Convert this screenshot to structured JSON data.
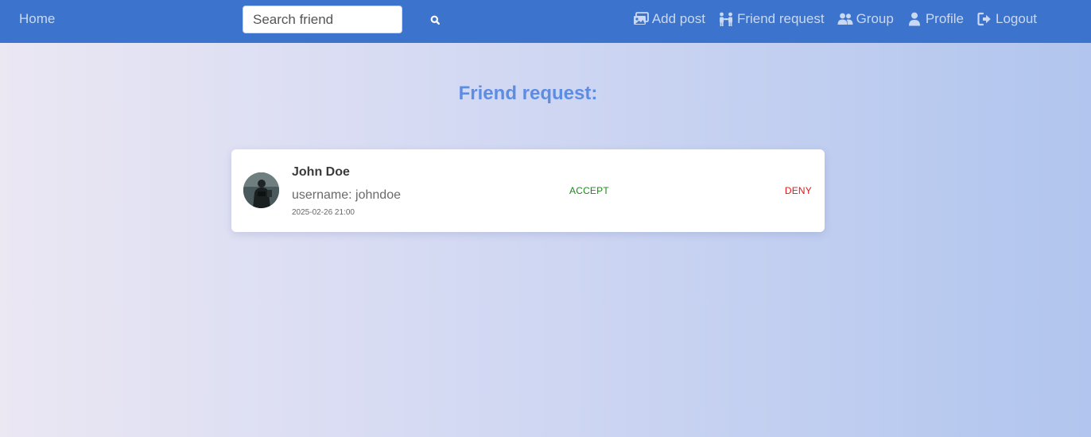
{
  "navbar": {
    "home_label": "Home",
    "search": {
      "placeholder": "Search friend",
      "value": "",
      "icon": "search-icon"
    },
    "links": [
      {
        "label": "Add post",
        "icon": "image-add-icon"
      },
      {
        "label": "Friend request",
        "icon": "user-pair-icon"
      },
      {
        "label": "Group",
        "icon": "users-icon"
      },
      {
        "label": "Profile",
        "icon": "user-icon"
      },
      {
        "label": "Logout",
        "icon": "logout-icon"
      }
    ]
  },
  "main": {
    "title": "Friend request:",
    "requests": [
      {
        "name": "John Doe",
        "username": "username: johndoe",
        "date": "2025-02-26 21:00",
        "accept_label": "ACCEPT",
        "deny_label": "DENY"
      }
    ]
  },
  "colors": {
    "navbar_bg": "#3c73cc",
    "nav_text": "#c9d9f3",
    "title": "#5d8de3",
    "accept": "#1a8a1a",
    "deny": "#e51515"
  }
}
